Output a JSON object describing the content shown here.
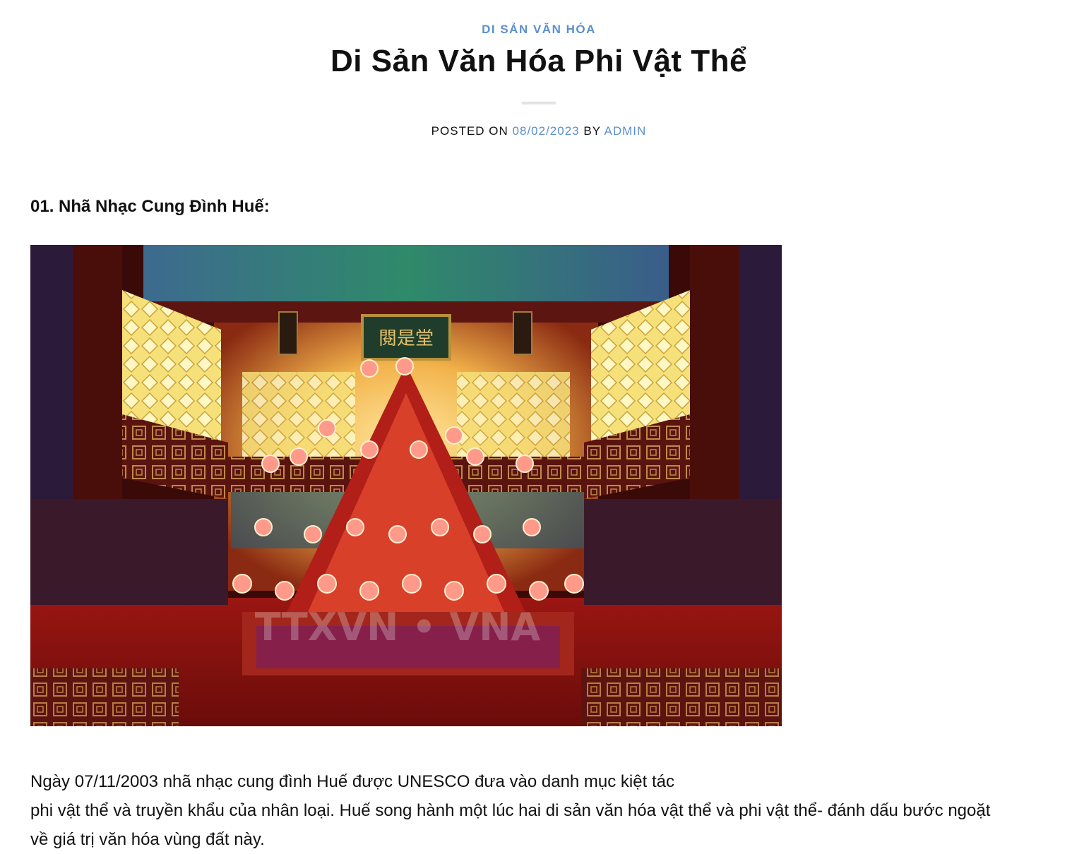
{
  "post": {
    "category": "DI SẢN VĂN HÓA",
    "title": "Di Sản Văn Hóa Phi Vật Thể",
    "meta": {
      "posted_on_label": "POSTED ON",
      "date": "08/02/2023",
      "by_label": "BY",
      "author": "ADMIN"
    }
  },
  "content": {
    "heading": "01. Nhã Nhạc Cung Đình Huế:",
    "image": {
      "placeholder": "royal-court-music-performance-photo",
      "watermark": "TTXVN • VNA",
      "signboard": "閱是堂"
    },
    "paragraph_lines": [
      "Ngày 07/11/2003 nhã nhạc cung đình Huế được UNESCO đưa vào danh mục kiệt tác",
      "phi vật thể và truyền khẩu của nhân loại. Huế song hành một lúc hai di sản văn hóa vật thể và phi vật thể- đánh dấu bước ngoặt",
      "về giá trị văn hóa vùng đất này."
    ]
  },
  "colors": {
    "accent": "#5b8fd1",
    "text": "#111111",
    "divider": "#e3e3e3"
  }
}
